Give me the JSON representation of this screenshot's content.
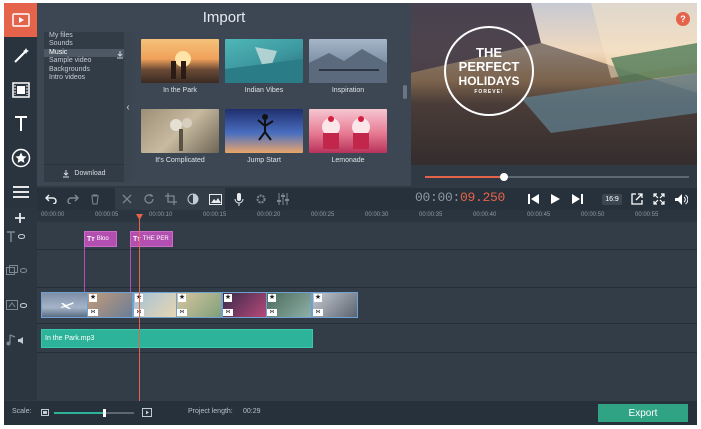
{
  "import": {
    "title": "Import",
    "categories": [
      "My files",
      "Sounds",
      "Music",
      "Sample video",
      "Backgrounds",
      "Intro videos"
    ],
    "selected_category": "Music",
    "download_label": "Download",
    "thumbnails": [
      {
        "label": "In the Park"
      },
      {
        "label": "Indian Vibes"
      },
      {
        "label": "Inspiration"
      },
      {
        "label": "It's Complicated"
      },
      {
        "label": "Jump Start"
      },
      {
        "label": "Lemonade"
      }
    ]
  },
  "preview": {
    "help": "?",
    "badge_lines": [
      "THE",
      "PERFECT",
      "HOLIDAYS",
      "FOREVE!"
    ],
    "seek_fraction": 0.3
  },
  "toolbar": {
    "timecode_dim": "00:00:",
    "timecode_active": "09.250",
    "aspect_ratio": "16:9"
  },
  "timeline": {
    "ticks": [
      "00:00:00",
      "00:00:05",
      "00:00:10",
      "00:00:15",
      "00:00:20",
      "00:00:25",
      "00:00:30",
      "00:00:35",
      "00:00:40",
      "00:00:45",
      "00:00:50",
      "00:00:55"
    ],
    "titles": [
      "Bloo",
      "THE PER"
    ],
    "audio_clip": "In the Park.mp3"
  },
  "footer": {
    "scale_label": "Scale:",
    "scale_fraction": 0.62,
    "project_length_label": "Project length:",
    "project_length": "00:29",
    "export_label": "Export"
  },
  "colors": {
    "accent": "#e5634a",
    "title_clip": "#b34fb1",
    "audio_clip": "#2db39a",
    "export": "#2fa384"
  }
}
